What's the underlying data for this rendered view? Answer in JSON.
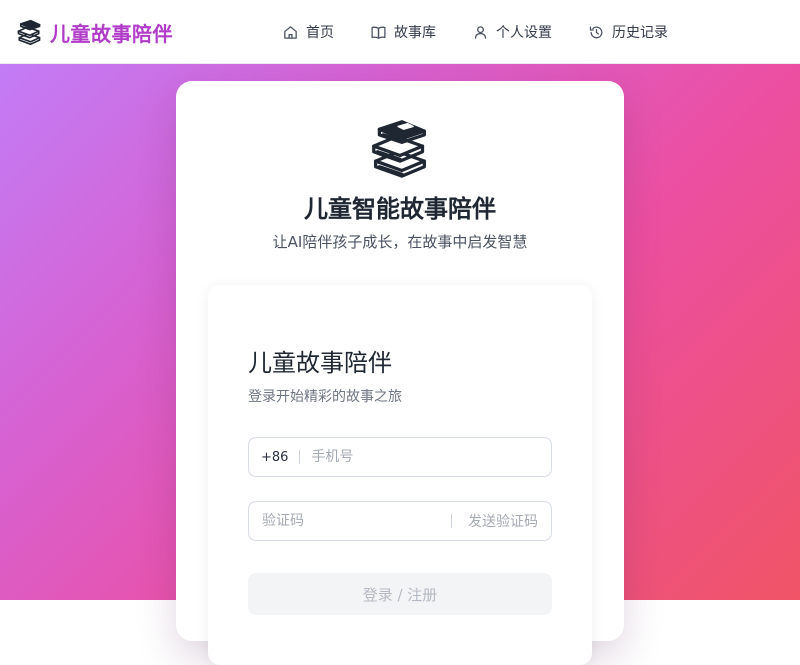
{
  "header": {
    "brand_icon": "books-icon",
    "brand_title": "儿童故事陪伴",
    "brand_color": "#b13cc8",
    "nav": [
      {
        "label": "首页",
        "icon": "home-icon"
      },
      {
        "label": "故事库",
        "icon": "book-open-icon"
      },
      {
        "label": "个人设置",
        "icon": "user-icon"
      },
      {
        "label": "历史记录",
        "icon": "history-icon"
      }
    ]
  },
  "background": {
    "gradient": [
      "#c27cf6",
      "#d761d1",
      "#ec4fa1",
      "#f05466"
    ]
  },
  "hero": {
    "icon": "books-icon",
    "title": "儿童智能故事陪伴",
    "subtitle": "让AI陪伴孩子成长，在故事中启发智慧"
  },
  "login_form": {
    "title": "儿童故事陪伴",
    "subtitle": "登录开始精彩的故事之旅",
    "phone": {
      "country_code": "+86",
      "placeholder": "手机号",
      "value": ""
    },
    "code": {
      "placeholder": "验证码",
      "value": "",
      "send_label": "发送验证码"
    },
    "submit_label": "登录 / 注册"
  }
}
